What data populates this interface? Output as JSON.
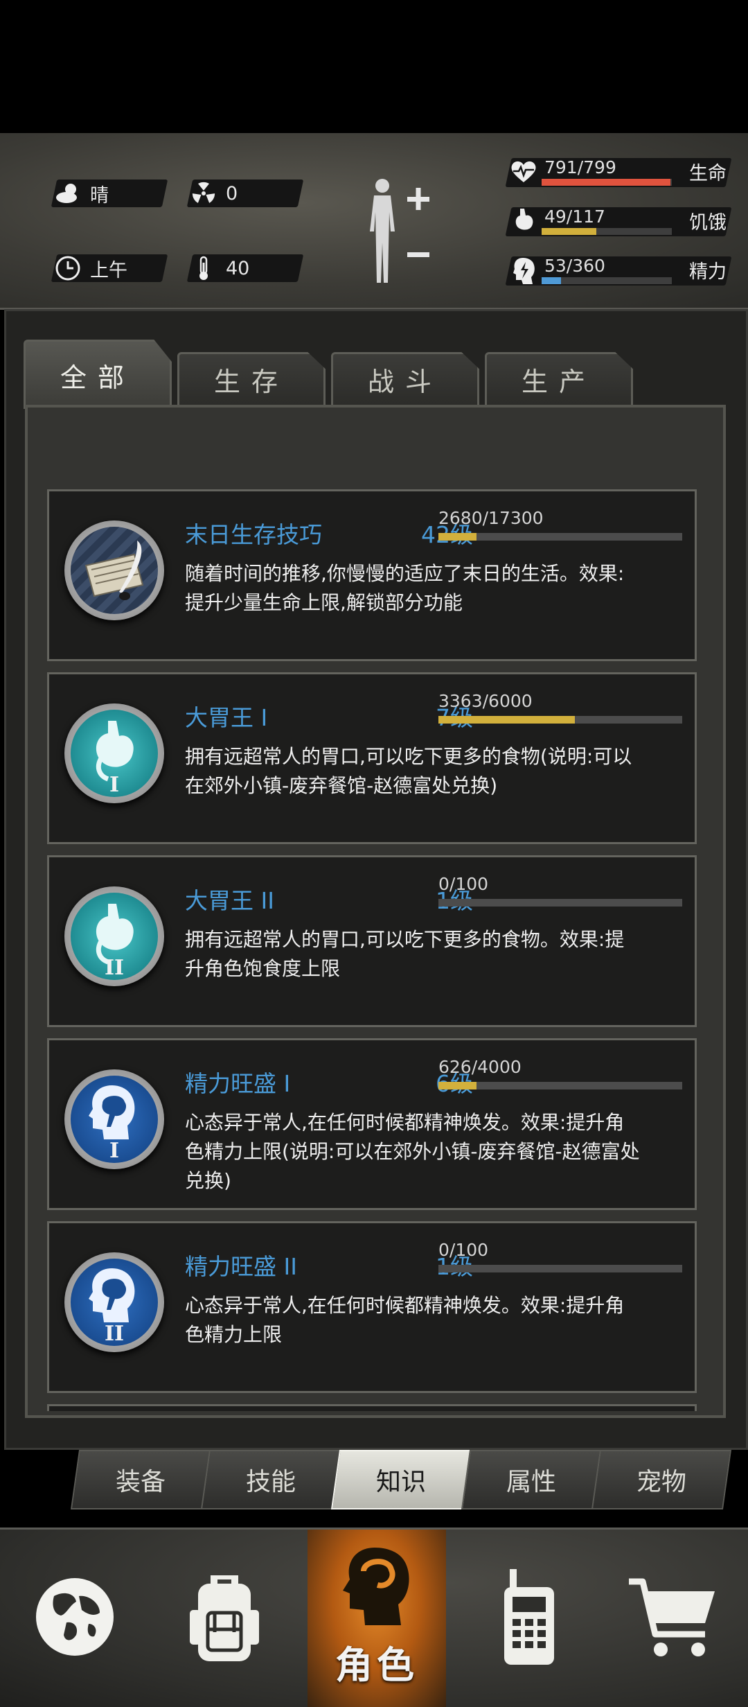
{
  "status": {
    "weather": {
      "icon": "cloud-sun-icon",
      "label": "晴"
    },
    "radiation": {
      "icon": "radiation-icon",
      "value": "0"
    },
    "time": {
      "icon": "clock-icon",
      "label": "上午"
    },
    "temperature": {
      "icon": "thermometer-icon",
      "value": "40"
    },
    "body_icon": "body-stats-icon",
    "stats": [
      {
        "icon": "heart-icon",
        "value": "791/799",
        "label": "生命",
        "fraction": 0.99,
        "color": "#e0533e"
      },
      {
        "icon": "stomach-icon",
        "value": "49/117",
        "label": "饥饿",
        "fraction": 0.42,
        "color": "#d2b03c"
      },
      {
        "icon": "energy-head-icon",
        "value": "53/360",
        "label": "精力",
        "fraction": 0.15,
        "color": "#4f9ad6"
      }
    ]
  },
  "tabs": [
    {
      "label": "全部",
      "active": true
    },
    {
      "label": "生存",
      "active": false
    },
    {
      "label": "战斗",
      "active": false
    },
    {
      "label": "生产",
      "active": false
    }
  ],
  "knowledge": [
    {
      "title": "末日生存技巧",
      "level": "42级",
      "progress": "2680/17300",
      "fraction": 0.155,
      "desc": "随着时间的推移,你慢慢的适应了末日的生活。效果:提升少量生命上限,解锁部分功能",
      "icon": "scroll-quill-icon"
    },
    {
      "title": "大胃王 I",
      "level": "7级",
      "progress": "3363/6000",
      "fraction": 0.56,
      "desc": "拥有远超常人的胃口,可以吃下更多的食物(说明:可以在郊外小镇-废弃餐馆-赵德富处兑换)",
      "icon": "stomach-badge-icon",
      "numeral": "I"
    },
    {
      "title": "大胃王 II",
      "level": "1级",
      "progress": "0/100",
      "fraction": 0,
      "desc": "拥有远超常人的胃口,可以吃下更多的食物。效果:提升角色饱食度上限",
      "icon": "stomach-badge-icon",
      "numeral": "II"
    },
    {
      "title": "精力旺盛 I",
      "level": "6级",
      "progress": "626/4000",
      "fraction": 0.156,
      "desc": "心态异于常人,在任何时候都精神焕发。效果:提升角色精力上限(说明:可以在郊外小镇-废弃餐馆-赵德富处兑换)",
      "icon": "brain-head-badge-icon",
      "numeral": "I"
    },
    {
      "title": "精力旺盛 II",
      "level": "1级",
      "progress": "0/100",
      "fraction": 0,
      "desc": "心态异于常人,在任何时候都精神焕发。效果:提升角色精力上限",
      "icon": "brain-head-badge-icon",
      "numeral": "II"
    }
  ],
  "sub_nav": [
    {
      "label": "装备",
      "active": false
    },
    {
      "label": "技能",
      "active": false
    },
    {
      "label": "知识",
      "active": true
    },
    {
      "label": "属性",
      "active": false
    },
    {
      "label": "宠物",
      "active": false
    }
  ],
  "bottom_nav": [
    {
      "icon": "globe-icon"
    },
    {
      "icon": "backpack-icon"
    },
    {
      "icon": "character-head-icon",
      "label": "角色",
      "active": true
    },
    {
      "icon": "walkie-talkie-icon"
    },
    {
      "icon": "shopping-cart-icon"
    }
  ]
}
